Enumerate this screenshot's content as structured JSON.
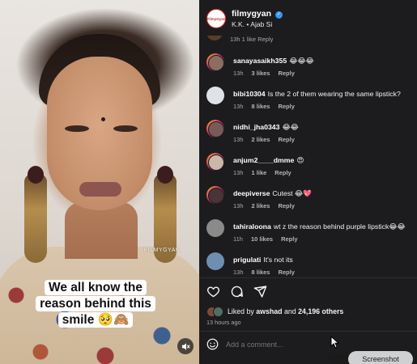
{
  "post": {
    "caption": "We all know the reason behind this smile 🥺🙈",
    "watermark": "FILMYGYAN"
  },
  "header": {
    "username": "filmygyan",
    "avatar_text": "FilmyGyan",
    "subtitle": "K.K. • Ajab Si"
  },
  "partial_comment_meta": "13h   1 like   Reply",
  "comments": [
    {
      "username": "sanayasaikh355",
      "text": "😂😂😂",
      "time": "13h",
      "likes": "3 likes",
      "reply": "Reply"
    },
    {
      "username": "bibi10304",
      "text": "Is the 2 of them wearing the same lipstick?",
      "time": "13h",
      "likes": "8 likes",
      "reply": "Reply"
    },
    {
      "username": "nidhi_jha0343",
      "text": "😂😂",
      "time": "13h",
      "likes": "2 likes",
      "reply": "Reply"
    },
    {
      "username": "anjum2____dmme",
      "text": "😍",
      "time": "13h",
      "likes": "1 like",
      "reply": "Reply"
    },
    {
      "username": "deepiverse",
      "text": "Cutest 😂💖",
      "time": "13h",
      "likes": "2 likes",
      "reply": "Reply"
    },
    {
      "username": "tahiraloona",
      "text": "wt z the reason behind purple lipstick😂😂",
      "time": "11h",
      "likes": "10 likes",
      "reply": "Reply"
    },
    {
      "username": "prigulati",
      "text": "It's not its",
      "time": "13h",
      "likes": "8 likes",
      "reply": "Reply"
    }
  ],
  "likes": {
    "prefix": "Liked by",
    "user": "awshad",
    "connector": "and",
    "count": "24,196 others"
  },
  "time_ago": "13 hours ago",
  "add_comment": {
    "placeholder": "Add a comment..."
  },
  "overlay": {
    "screenshot_label": "Screenshot"
  },
  "colors": {
    "verified": "#3897f0",
    "panel_bg": "#1c1c1e",
    "story_ring": "#d2226f"
  }
}
